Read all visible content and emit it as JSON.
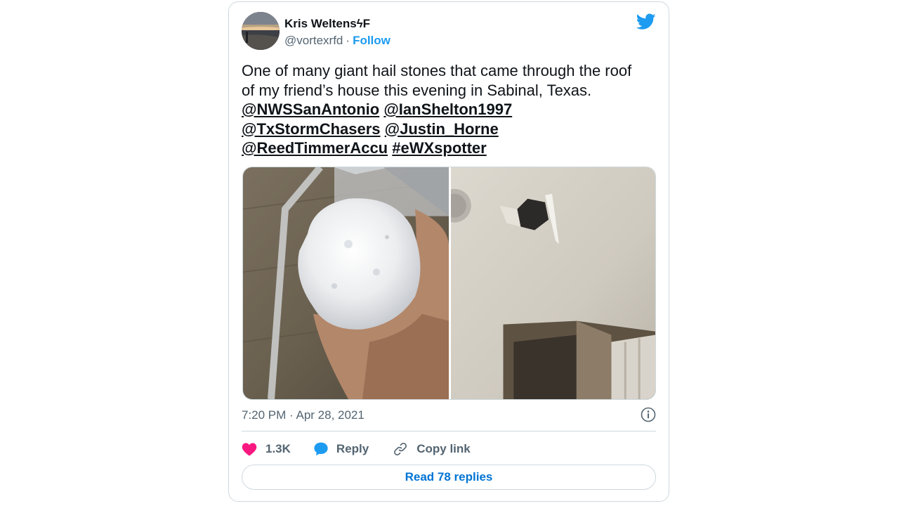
{
  "author": {
    "name": "Kris WeltensϟF",
    "handle": "@vortexrfd",
    "separator": "·",
    "follow_label": "Follow"
  },
  "tweet": {
    "text_lines": [
      "One of many giant hail stones that came through the roof",
      "of my friend’s house this evening in Sabinal, Texas."
    ],
    "mentions": [
      "@NWSSanAntonio",
      "@IanShelton1997",
      "@TxStormChasers",
      "@Justin_Horne",
      "@ReedTimmerAccu",
      "#eWXspotter"
    ],
    "timestamp": "7:20 PM · Apr 28, 2021"
  },
  "engagement": {
    "likes": "1.3K",
    "reply_label": "Reply",
    "copy_link_label": "Copy link",
    "read_replies_label": "Read 78 replies"
  },
  "icons": {
    "brand": "twitter-bird-icon",
    "like": "heart-icon",
    "reply": "speech-bubble-icon",
    "copy": "link-icon",
    "info": "info-icon"
  },
  "colors": {
    "brand_blue": "#1d9bf0",
    "read_replies_blue": "#0074d4",
    "like_pink": "#f91880",
    "text_primary": "#0f1419",
    "text_secondary": "#536471",
    "border": "#cfd9de"
  }
}
